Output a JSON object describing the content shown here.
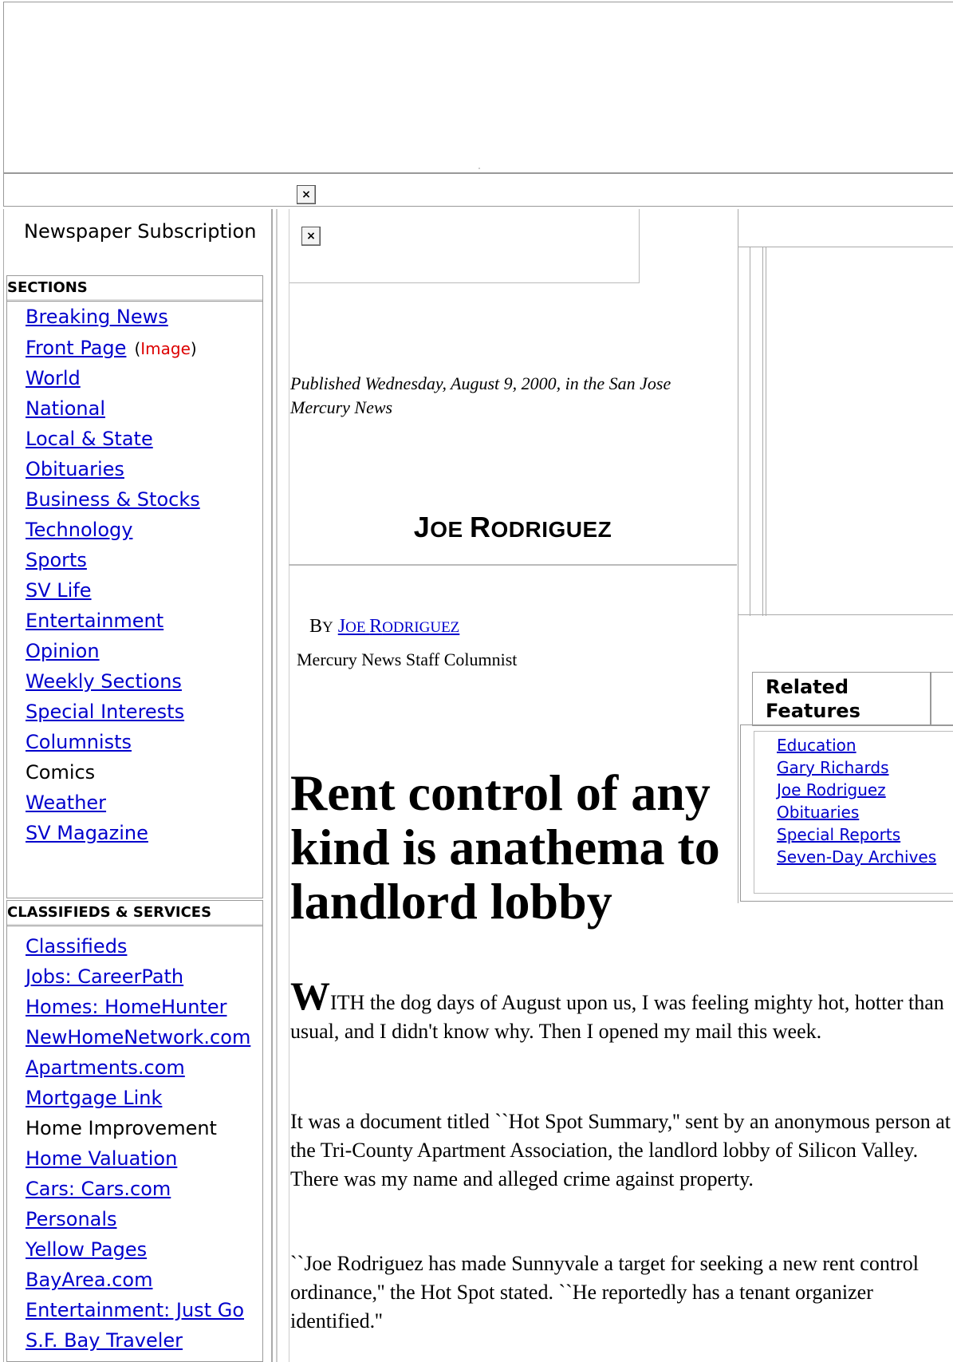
{
  "header": {
    "close_icon_1": "×",
    "close_icon_2": "×"
  },
  "sidebar": {
    "subscription": "Newspaper Subscription",
    "sections_title": "SECTIONS",
    "sections": [
      {
        "label": "Breaking News",
        "link": true
      },
      {
        "label": "Front Page",
        "link": true,
        "suffix_open": "(",
        "suffix_link": "Image",
        "suffix_close": ")"
      },
      {
        "label": "World",
        "link": true
      },
      {
        "label": "National",
        "link": true
      },
      {
        "label": "Local & State",
        "link": true
      },
      {
        "label": "Obituaries",
        "link": true
      },
      {
        "label": "Business & Stocks",
        "link": true
      },
      {
        "label": "Technology",
        "link": true
      },
      {
        "label": "Sports",
        "link": true
      },
      {
        "label": "SV Life",
        "link": true
      },
      {
        "label": "Entertainment",
        "link": true
      },
      {
        "label": "Opinion",
        "link": true
      },
      {
        "label": "Weekly Sections",
        "link": true
      },
      {
        "label": "Special Interests",
        "link": true
      },
      {
        "label": "Columnists",
        "link": true
      },
      {
        "label": "Comics",
        "link": false
      },
      {
        "label": "Weather",
        "link": true
      },
      {
        "label": "SV Magazine",
        "link": true
      }
    ],
    "classifieds_title": "CLASSIFIEDS & SERVICES",
    "classifieds": [
      {
        "label": "Classifieds",
        "link": true
      },
      {
        "label": "Jobs: CareerPath",
        "link": true
      },
      {
        "label": "Homes: HomeHunter",
        "link": true
      },
      {
        "label": "NewHomeNetwork.com",
        "link": true
      },
      {
        "label": "Apartments.com",
        "link": true
      },
      {
        "label": "Mortgage Link",
        "link": true
      },
      {
        "label": "Home Improvement",
        "link": false
      },
      {
        "label": "Home Valuation",
        "link": true
      },
      {
        "label": "Cars: Cars.com",
        "link": true
      },
      {
        "label": "Personals",
        "link": true
      },
      {
        "label": "Yellow Pages",
        "link": true
      },
      {
        "label": "BayArea.com",
        "link": true
      },
      {
        "label": "Entertainment: Just Go",
        "link": true
      },
      {
        "label": "S.F. Bay Traveler",
        "link": true
      }
    ]
  },
  "article": {
    "published": "Published Wednesday, August 9, 2000, in the San Jose Mercury News",
    "column_title_j": "J",
    "column_title_oe": "OE ",
    "column_title_r": "R",
    "column_title_odriguez": "ODRIGUEZ",
    "by_b": "B",
    "by_y": "Y",
    "author_j": "J",
    "author_oe": "OE ",
    "author_r": "R",
    "author_odriguez": "ODRIGUEZ",
    "staff": "Mercury News Staff Columnist",
    "headline": "Rent control of any kind is anathema to landlord lobby",
    "dropcap": "W",
    "p1": "ITH the dog days of August upon us, I was feeling mighty hot, hotter than usual, and I didn't know why. Then I opened my mail this week.",
    "p2": "It was a document titled ``Hot Spot Summary,'' sent by an anonymous person at the Tri-County Apartment Association, the landlord lobby of Silicon Valley. There was my name and alleged crime against property.",
    "p3": "``Joe Rodriguez has made Sunnyvale a target for seeking a new rent control ordinance,'' the Hot Spot stated. ``He reportedly has a tenant organizer identified.''"
  },
  "related": {
    "title": "Related Features",
    "links": [
      "Education",
      "Gary Richards",
      "Joe Rodriguez",
      "Obituaries",
      "Special Reports",
      "Seven-Day Archives"
    ]
  }
}
